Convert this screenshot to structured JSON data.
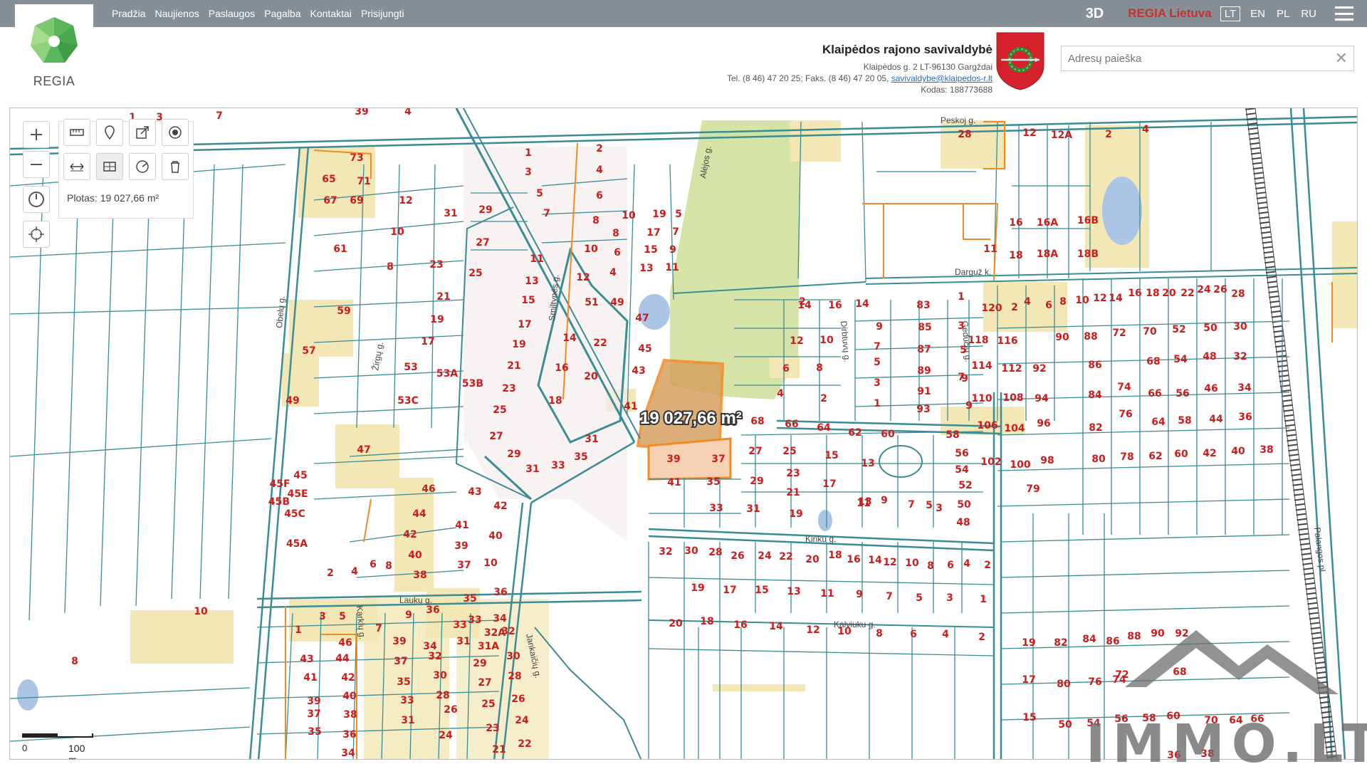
{
  "nav": [
    "Pradžia",
    "Naujienos",
    "Paslaugos",
    "Pagalba",
    "Kontaktai",
    "Prisijungti"
  ],
  "top_right": {
    "mode3d": "3D",
    "brand": "REGIA Lietuva",
    "languages": [
      "LT",
      "EN",
      "PL",
      "RU"
    ],
    "active_language": "LT"
  },
  "logo": {
    "text": "REGIA"
  },
  "municipality": {
    "title": "Klaipėdos rajono savivaldybė",
    "address": "Klaipėdos g. 2 LT-96130 Gargždai",
    "phones": "Tel. (8 46) 47 20 25; Faks. (8 46) 47 20 05, ",
    "email": "savivaldybe@klaipedos-r.lt",
    "code": "Kodas: 188773688"
  },
  "search": {
    "placeholder": "Adresų paieška",
    "clear": "✕"
  },
  "measure": {
    "area_label": "Plotas: 19 027,66 m²",
    "map_label": "19 027,66 m²"
  },
  "scale": {
    "zero": "0",
    "length": "100 m"
  },
  "streets": [
    "Peskoj g.",
    "Darguž k.",
    "Alėjos g.",
    "Smiltynės g.",
    "Lauku g.",
    "Karklų g.",
    "Jankaičių g.",
    "Kiriku g.",
    "Kalviuku g.",
    "Palangos pl.",
    "Gedučių g.",
    "Dirbtuvų g.",
    "Obelų g.",
    "Žirgų g."
  ],
  "watermark": "IMMO.LT",
  "colors": {
    "topbar": "#868e97",
    "parcel_line": "#3a8c95",
    "plot_label": "#cc1d1d",
    "building_area": "#f2e7b5",
    "green_area": "#d5e4a6",
    "selected_fill": "#d4a05f",
    "orange_line": "#f08a24",
    "brand_red": "#c8312b"
  },
  "icons": [
    "plus-icon",
    "minus-icon",
    "compass-icon",
    "locate-icon",
    "ruler-icon",
    "pin-icon",
    "export-icon",
    "target-icon",
    "length-measure-icon",
    "area-measure-icon",
    "circle-measure-icon",
    "trash-icon"
  ]
}
